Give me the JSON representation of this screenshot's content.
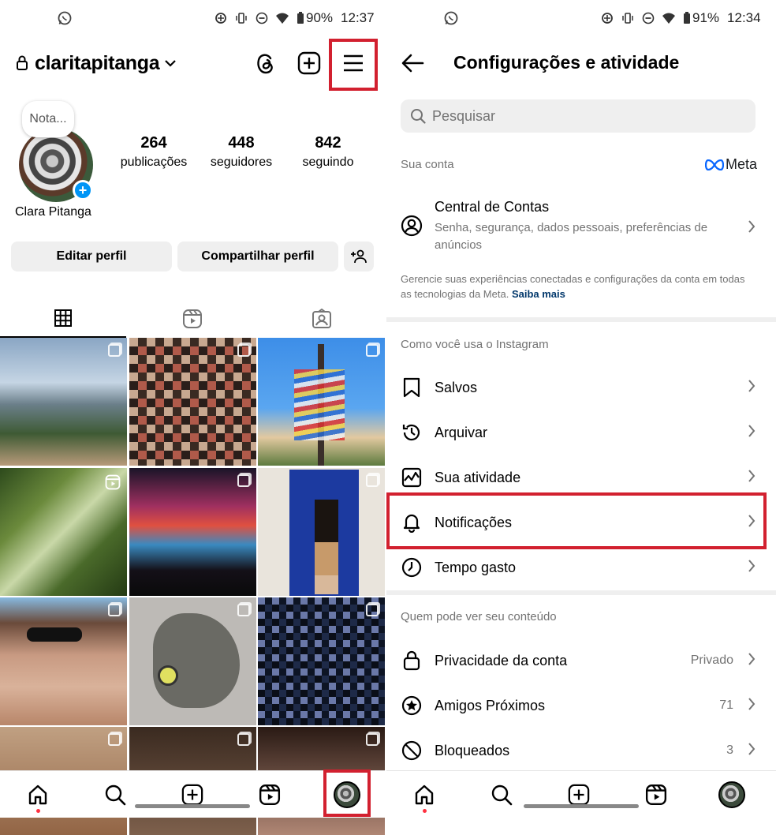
{
  "left": {
    "status": {
      "battery": "90%",
      "time": "12:37"
    },
    "header": {
      "username": "claritapitanga"
    },
    "profile": {
      "note": "Nota...",
      "display_name": "Clara Pitanga",
      "stats": [
        {
          "num": "264",
          "label": "publicações"
        },
        {
          "num": "448",
          "label": "seguidores"
        },
        {
          "num": "842",
          "label": "seguindo"
        }
      ]
    },
    "buttons": {
      "edit": "Editar perfil",
      "share": "Compartilhar perfil"
    }
  },
  "right": {
    "status": {
      "battery": "91%",
      "time": "12:34"
    },
    "title": "Configurações e atividade",
    "search": {
      "placeholder": "Pesquisar"
    },
    "account": {
      "section": "Sua conta",
      "meta_logo": "Meta",
      "center_title": "Central de Contas",
      "center_sub": "Senha, segurança, dados pessoais, preferências de anúncios",
      "disclaimer": "Gerencie suas experiências conectadas e configurações da conta em todas as tecnologias da Meta.",
      "learn_more": "Saiba mais"
    },
    "usage": {
      "section": "Como você usa o Instagram",
      "items": [
        {
          "label": "Salvos"
        },
        {
          "label": "Arquivar"
        },
        {
          "label": "Sua atividade"
        },
        {
          "label": "Notificações"
        },
        {
          "label": "Tempo gasto"
        }
      ]
    },
    "visibility": {
      "section": "Quem pode ver seu conteúdo",
      "items": [
        {
          "label": "Privacidade da conta",
          "value": "Privado"
        },
        {
          "label": "Amigos Próximos",
          "value": "71"
        },
        {
          "label": "Bloqueados",
          "value": "3"
        }
      ]
    }
  },
  "colors": {
    "highlight": "#d2202f",
    "link": "#00376b",
    "blue": "#0095f6"
  },
  "icons": [
    "whatsapp-icon",
    "lock-icon",
    "threads-icon",
    "plus-square-icon",
    "menu-icon",
    "grid-icon",
    "reels-icon",
    "tagged-icon",
    "home-icon",
    "search-icon",
    "bookmark-icon",
    "archive-icon",
    "activity-icon",
    "bell-icon",
    "clock-icon",
    "star-icon",
    "block-icon",
    "user-circle-icon",
    "back-arrow-icon"
  ]
}
